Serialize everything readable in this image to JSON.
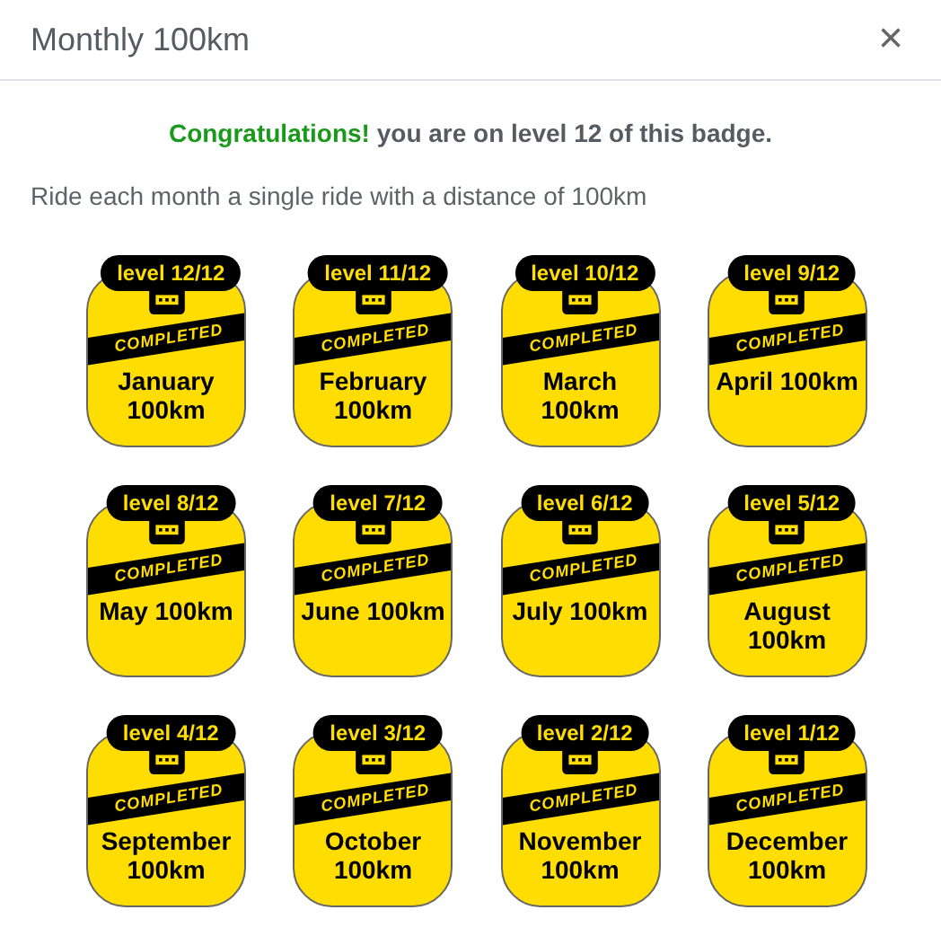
{
  "dialog": {
    "title": "Monthly 100km",
    "close": "×"
  },
  "message": {
    "highlight": "Congratulations!",
    "text": "you are on level 12 of this badge."
  },
  "description": "Ride each month a single ride with a distance of 100km",
  "badges": [
    {
      "level": "level 12/12",
      "status": "COMPLETED",
      "name": "January 100km"
    },
    {
      "level": "level 11/12",
      "status": "COMPLETED",
      "name": "February 100km"
    },
    {
      "level": "level 10/12",
      "status": "COMPLETED",
      "name": "March 100km"
    },
    {
      "level": "level 9/12",
      "status": "COMPLETED",
      "name": "April 100km"
    },
    {
      "level": "level 8/12",
      "status": "COMPLETED",
      "name": "May 100km"
    },
    {
      "level": "level 7/12",
      "status": "COMPLETED",
      "name": "June 100km"
    },
    {
      "level": "level 6/12",
      "status": "COMPLETED",
      "name": "July 100km"
    },
    {
      "level": "level 5/12",
      "status": "COMPLETED",
      "name": "August 100km"
    },
    {
      "level": "level 4/12",
      "status": "COMPLETED",
      "name": "September 100km"
    },
    {
      "level": "level 3/12",
      "status": "COMPLETED",
      "name": "October 100km"
    },
    {
      "level": "level 2/12",
      "status": "COMPLETED",
      "name": "November 100km"
    },
    {
      "level": "level 1/12",
      "status": "COMPLETED",
      "name": "December 100km"
    }
  ]
}
